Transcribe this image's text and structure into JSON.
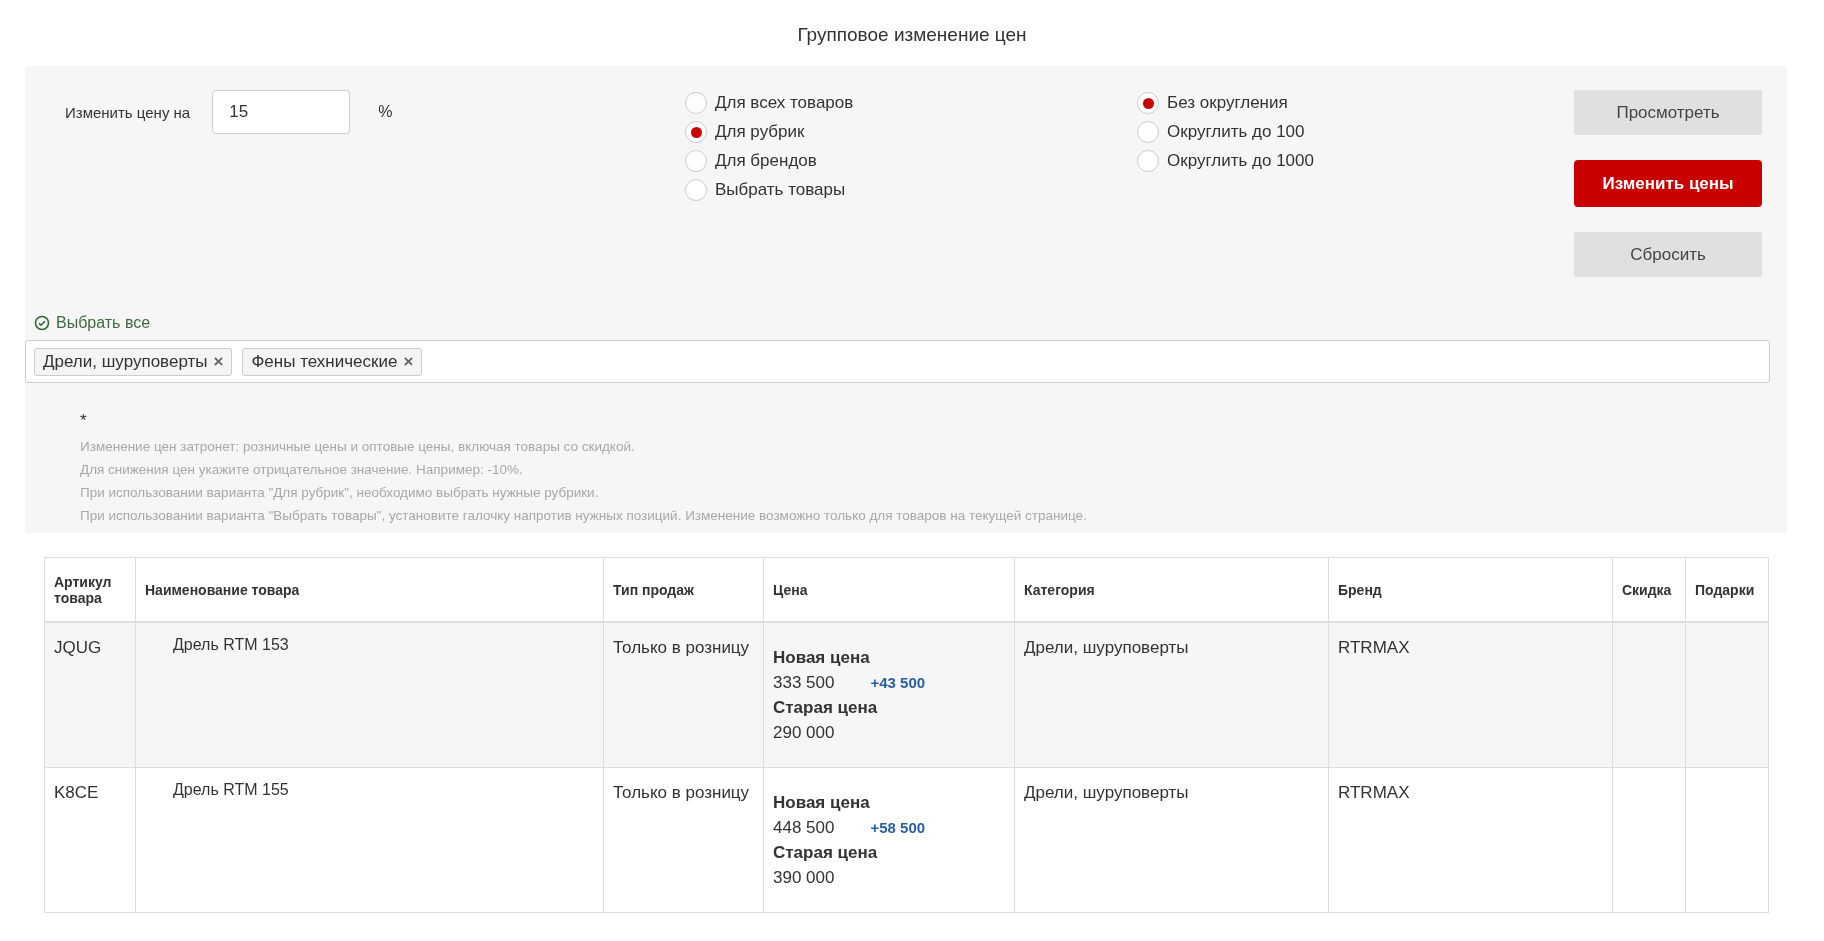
{
  "title": "Групповое изменение цен",
  "change": {
    "label": "Изменить цену на",
    "value": "15",
    "unit": "%"
  },
  "scope_options": [
    {
      "label": "Для всех товаров",
      "selected": false
    },
    {
      "label": "Для рубрик",
      "selected": true
    },
    {
      "label": "Для брендов",
      "selected": false
    },
    {
      "label": "Выбрать товары",
      "selected": false
    }
  ],
  "rounding_options": [
    {
      "label": "Без округления",
      "selected": true
    },
    {
      "label": "Округлить до 100",
      "selected": false
    },
    {
      "label": "Округлить до 1000",
      "selected": false
    }
  ],
  "buttons": [
    {
      "label": "Просмотреть",
      "kind": "secondary"
    },
    {
      "label": "Изменить цены",
      "kind": "primary"
    },
    {
      "label": "Сбросить",
      "kind": "secondary"
    }
  ],
  "select_all": "Выбрать все",
  "tags": [
    "Дрели, шуруповерты",
    "Фены технические"
  ],
  "tag_remove": "×",
  "notes_mark": "*",
  "notes": [
    "Изменение цен затронет: розничные цены и оптовые цены, включая товары со скидкой.",
    "Для снижения цен укажите отрицательное значение. Например: -10%.",
    "При использовании варианта \"Для рубрик\", необходимо выбрать нужные рубрики.",
    "При использовании варианта \"Выбрать товары\", установите галочку напротив нужных позиций. Изменение возможно только для товаров на текущей странице."
  ],
  "table": {
    "columns": [
      "Артикул товара",
      "Наименование товара",
      "Тип продаж",
      "Цена",
      "Категория",
      "Бренд",
      "Скидка",
      "Подарки"
    ],
    "rows": [
      {
        "sku": "JQUG",
        "name": "Дрель RTM 153",
        "sale_type": "Только в розницу",
        "new_price_label": "Новая цена",
        "new_price": "333 500",
        "delta": "+43 500",
        "old_price_label": "Старая цена",
        "old_price": "290 000",
        "category": "Дрели, шуруповерты",
        "brand": "RTRMAX"
      },
      {
        "sku": "K8CE",
        "name": "Дрель RTM 155",
        "sale_type": "Только в розницу",
        "new_price_label": "Новая цена",
        "new_price": "448 500",
        "delta": "+58 500",
        "old_price_label": "Старая цена",
        "old_price": "390 000",
        "category": "Дрели, шуруповерты",
        "brand": "RTRMAX"
      }
    ]
  }
}
